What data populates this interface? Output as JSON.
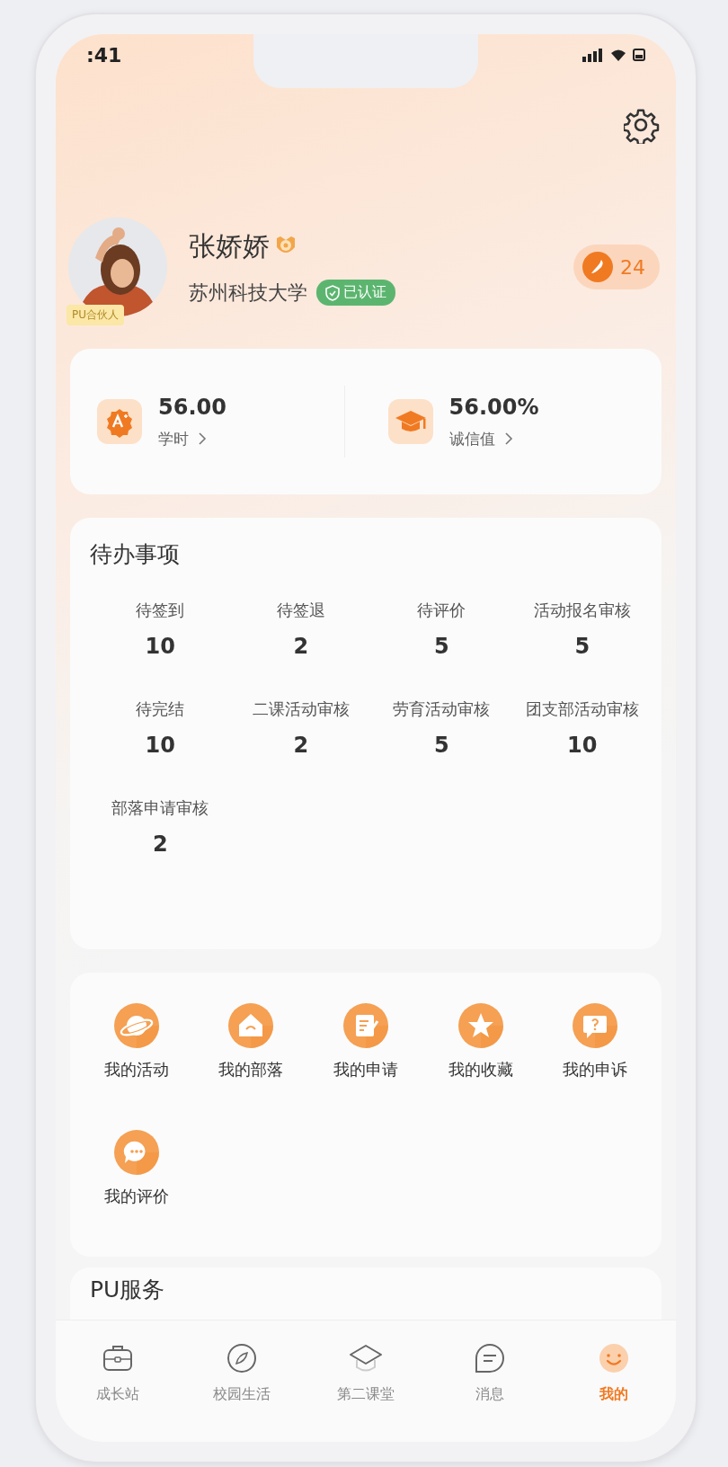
{
  "status_bar": {
    "time": ":41"
  },
  "profile": {
    "name": "张娇娇",
    "school": "苏州科技大学",
    "verified_label": "已认证",
    "partner_badge": "PU合伙人",
    "coins": "24"
  },
  "stats": [
    {
      "kind": "hours",
      "value": "56.00",
      "label": "学时"
    },
    {
      "kind": "integrity",
      "value": "56.00%",
      "label": "诚信值"
    }
  ],
  "todo": {
    "title": "待办事项",
    "items": [
      {
        "label": "待签到",
        "count": "10"
      },
      {
        "label": "待签退",
        "count": "2"
      },
      {
        "label": "待评价",
        "count": "5"
      },
      {
        "label": "活动报名审核",
        "count": "5"
      },
      {
        "label": "待完结",
        "count": "10"
      },
      {
        "label": "二课活动审核",
        "count": "2"
      },
      {
        "label": "劳育活动审核",
        "count": "5"
      },
      {
        "label": "团支部活动审核",
        "count": "10"
      },
      {
        "label": "部落申请审核",
        "count": "2"
      }
    ]
  },
  "shortcuts": [
    {
      "kind": "planet",
      "label": "我的活动"
    },
    {
      "kind": "house",
      "label": "我的部落"
    },
    {
      "kind": "form",
      "label": "我的申请"
    },
    {
      "kind": "star",
      "label": "我的收藏"
    },
    {
      "kind": "question",
      "label": "我的申诉"
    },
    {
      "kind": "chat",
      "label": "我的评价"
    }
  ],
  "services": {
    "title": "PU服务"
  },
  "tab_bar": [
    {
      "kind": "briefcase",
      "label": "成长站",
      "selected": false
    },
    {
      "kind": "compass",
      "label": "校园生活",
      "selected": false
    },
    {
      "kind": "cap",
      "label": "第二课堂",
      "selected": false
    },
    {
      "kind": "message",
      "label": "消息",
      "selected": false
    },
    {
      "kind": "smile",
      "label": "我的",
      "selected": true
    }
  ]
}
